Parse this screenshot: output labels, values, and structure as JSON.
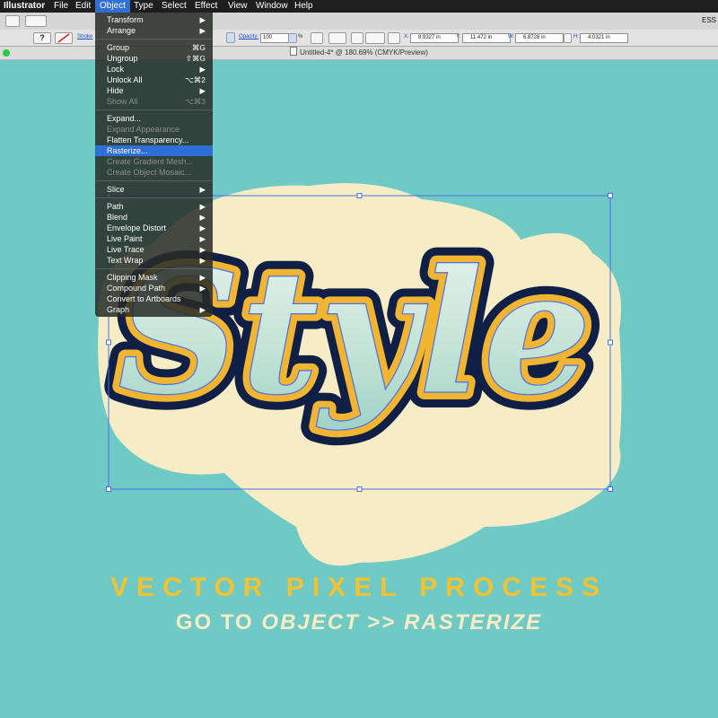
{
  "menubar": {
    "app": "Illustrator",
    "items": [
      "File",
      "Edit",
      "Object",
      "Type",
      "Select",
      "Effect",
      "View",
      "Window",
      "Help"
    ],
    "right_label": "ESS"
  },
  "toolbar": {
    "stroke_label": "Stroke",
    "opacity_label": "Opacity:",
    "opacity_value": "100",
    "percent": "%",
    "x_label": "X:",
    "x_value": "8.9327 in",
    "y_label": "Y:",
    "y_value": "11.472 in",
    "w_label": "W:",
    "w_value": "6.8728 in",
    "h_label": "H:",
    "h_value": "4.0321 in"
  },
  "document": {
    "title": "Untitled-4* @ 180.69% (CMYK/Preview)"
  },
  "object_menu": {
    "groups": [
      [
        {
          "label": "Transform",
          "key": "▶",
          "disabled": false
        },
        {
          "label": "Arrange",
          "key": "▶",
          "disabled": false
        }
      ],
      [
        {
          "label": "Group",
          "key": "⌘G",
          "disabled": false
        },
        {
          "label": "Ungroup",
          "key": "⇧⌘G",
          "disabled": false
        },
        {
          "label": "Lock",
          "key": "▶",
          "disabled": false
        },
        {
          "label": "Unlock All",
          "key": "⌥⌘2",
          "disabled": false
        },
        {
          "label": "Hide",
          "key": "▶",
          "disabled": false
        },
        {
          "label": "Show All",
          "key": "⌥⌘3",
          "disabled": true
        }
      ],
      [
        {
          "label": "Expand...",
          "key": "",
          "disabled": false
        },
        {
          "label": "Expand Appearance",
          "key": "",
          "disabled": true
        },
        {
          "label": "Flatten Transparency...",
          "key": "",
          "disabled": false
        },
        {
          "label": "Rasterize...",
          "key": "",
          "disabled": false,
          "highlighted": true
        },
        {
          "label": "Create Gradient Mesh...",
          "key": "",
          "disabled": true
        },
        {
          "label": "Create Object Mosaic...",
          "key": "",
          "disabled": true
        }
      ],
      [
        {
          "label": "Slice",
          "key": "▶",
          "disabled": false
        }
      ],
      [
        {
          "label": "Path",
          "key": "▶",
          "disabled": false
        },
        {
          "label": "Blend",
          "key": "▶",
          "disabled": false
        },
        {
          "label": "Envelope Distort",
          "key": "▶",
          "disabled": false
        },
        {
          "label": "Live Paint",
          "key": "▶",
          "disabled": false
        },
        {
          "label": "Live Trace",
          "key": "▶",
          "disabled": false
        },
        {
          "label": "Text Wrap",
          "key": "▶",
          "disabled": false
        }
      ],
      [
        {
          "label": "Clipping Mask",
          "key": "▶",
          "disabled": false
        },
        {
          "label": "Compound Path",
          "key": "▶",
          "disabled": false
        },
        {
          "label": "Convert to Artboards",
          "key": "",
          "disabled": false
        },
        {
          "label": "Graph",
          "key": "▶",
          "disabled": false
        }
      ]
    ]
  },
  "artwork": {
    "text": "Style",
    "colors": {
      "background": "#6fc9c5",
      "sticker": "#f6ecc5",
      "outline": "#0f1f45",
      "gold": "#f2b531",
      "fill": "#cfe8d8",
      "selection": "#4a6fe8"
    }
  },
  "caption": {
    "line1": "VECTOR PIXEL PROCESS",
    "line2_prefix": "GO TO ",
    "line2_object": "OBJECT",
    "line2_sep": " >> ",
    "line2_rasterize": "RASTERIZE"
  }
}
